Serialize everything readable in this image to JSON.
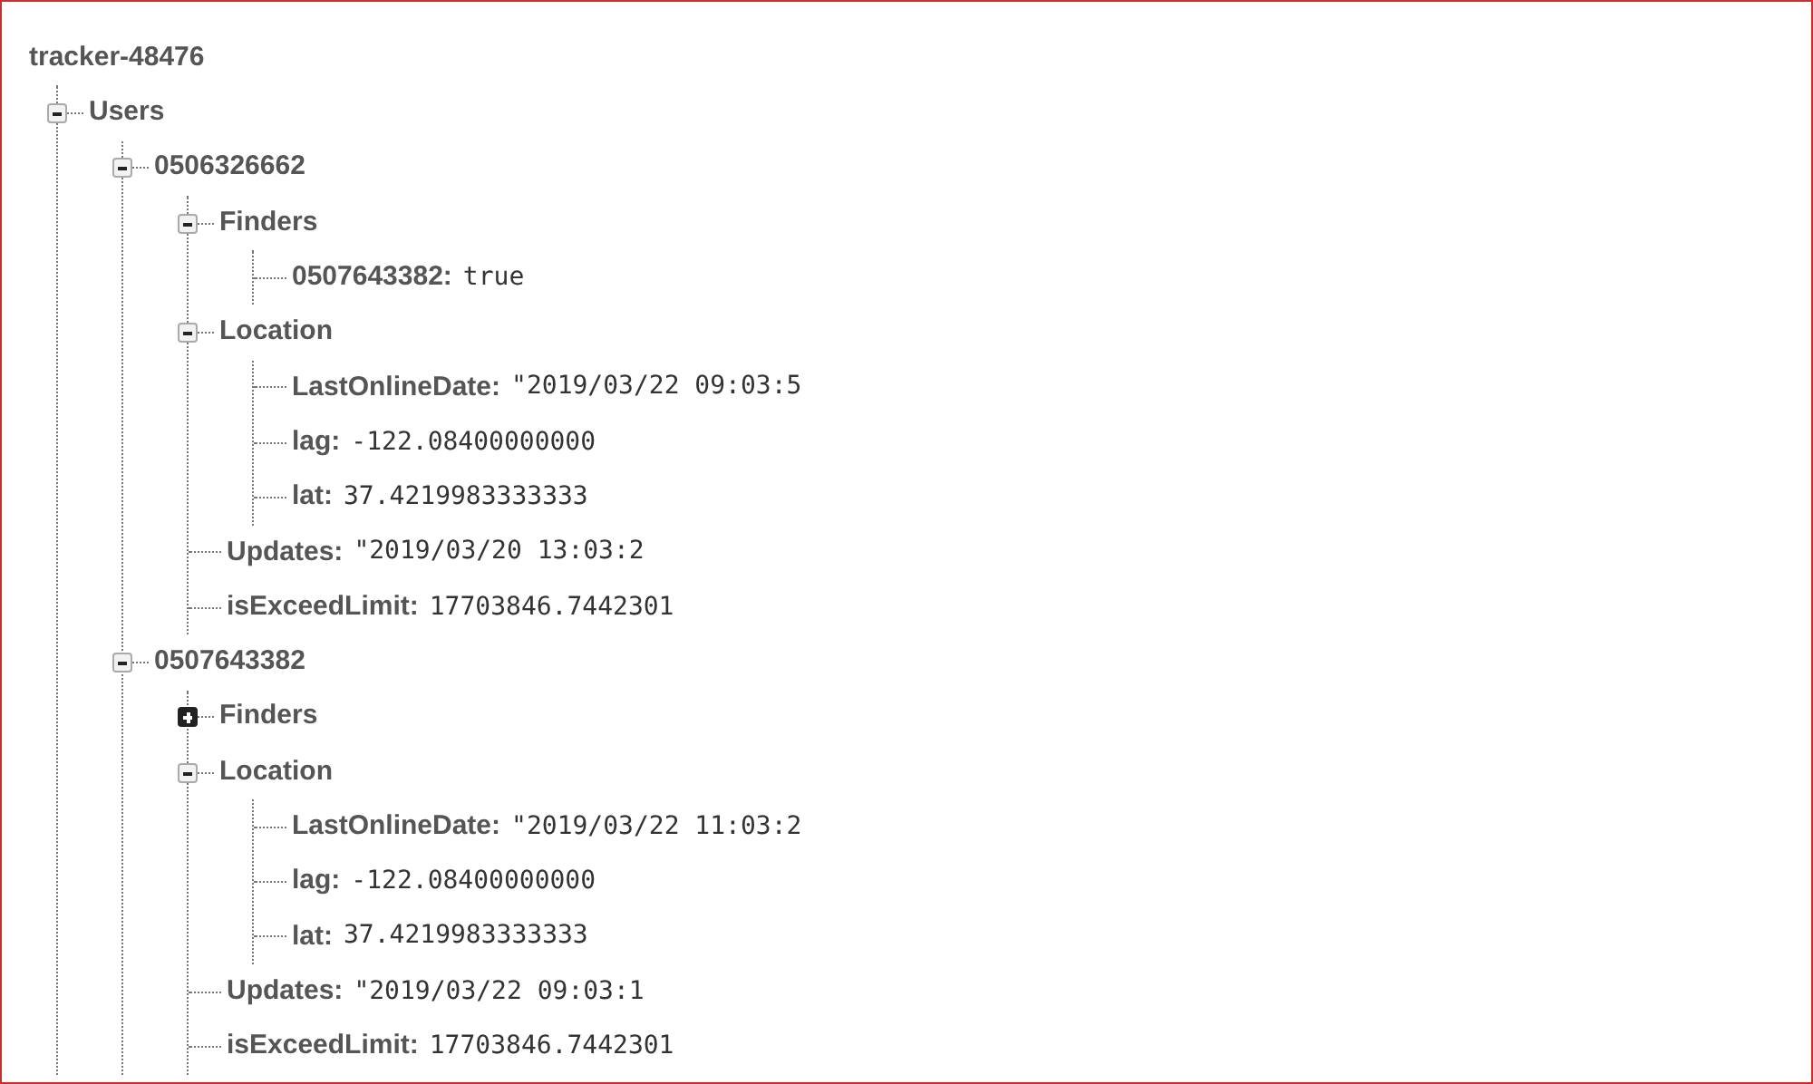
{
  "tree": {
    "key": "tracker-48476",
    "children": [
      {
        "key": "Users",
        "expanded": true,
        "children": [
          {
            "key": "0506326662",
            "expanded": true,
            "children": [
              {
                "key": "Finders",
                "expanded": true,
                "children": [
                  {
                    "key": "0507643382:",
                    "value": "true"
                  }
                ]
              },
              {
                "key": "Location",
                "expanded": true,
                "children": [
                  {
                    "key": "LastOnlineDate:",
                    "value": "\"2019/03/22 09:03:5"
                  },
                  {
                    "key": "lag:",
                    "value": "-122.08400000000"
                  },
                  {
                    "key": "lat:",
                    "value": "37.4219983333333"
                  }
                ]
              },
              {
                "key": "Updates:",
                "value": "\"2019/03/20 13:03:2"
              },
              {
                "key": "isExceedLimit:",
                "value": "17703846.7442301"
              }
            ]
          },
          {
            "key": "0507643382",
            "expanded": true,
            "children": [
              {
                "key": "Finders",
                "expanded": false
              },
              {
                "key": "Location",
                "expanded": true,
                "children": [
                  {
                    "key": "LastOnlineDate:",
                    "value": "\"2019/03/22 11:03:2"
                  },
                  {
                    "key": "lag:",
                    "value": "-122.08400000000"
                  },
                  {
                    "key": "lat:",
                    "value": "37.4219983333333"
                  }
                ]
              },
              {
                "key": "Updates:",
                "value": "\"2019/03/22 09:03:1"
              },
              {
                "key": "isExceedLimit:",
                "value": "17703846.7442301"
              }
            ]
          }
        ]
      }
    ]
  }
}
